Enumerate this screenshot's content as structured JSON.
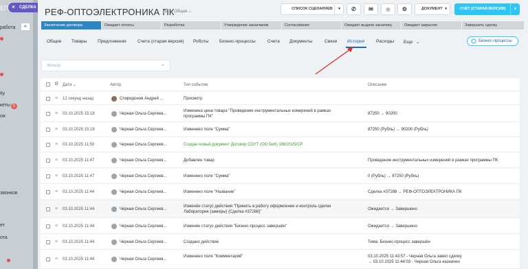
{
  "background": {
    "sidebar_fragments": [
      "работа",
      "ity",
      "кеты",
      "оя",
      "звонков",
      "ет",
      "ота"
    ],
    "sidebar_badge": "5",
    "top_logo_fragment": "ЕП"
  },
  "deal_tab": {
    "close_glyph": "✕",
    "label": "СДЕЛКА"
  },
  "collapse_icon": "«",
  "header": {
    "title": "РЕФ-ОПТОЭЛЕКТРОНИКА ПК",
    "title_icons": "🔗 ✎",
    "funnel": "Общая",
    "funnel_chevron": "⌄",
    "scenarios_label": "СПИСОК СЦЕНАРИЕВ",
    "scenarios_chevron": "▾",
    "phone_icon": "✆",
    "mail_icon": "✉",
    "status_icon": "◉",
    "gear_icon": "⚙",
    "document_label": "ДОКУМЕНТ",
    "document_chevron": "▾",
    "invoice_label": "СЧЁТ (СТАРАЯ ВЕРСИЯ)",
    "invoice_chevron": "▾"
  },
  "stages": [
    {
      "label": "Заключение договора",
      "active": true
    },
    {
      "label": "Ожидает оплаты",
      "active": false
    },
    {
      "label": "Разработка",
      "active": false
    },
    {
      "label": "Утверждение заказчиком",
      "active": false
    },
    {
      "label": "Согласование",
      "active": false
    },
    {
      "label": "Ожидает выдачи заказчику",
      "active": false
    },
    {
      "label": "Ожидает закрытия",
      "active": false
    },
    {
      "label": "Завершить сделку",
      "active": false
    }
  ],
  "tabs": [
    {
      "label": "Общие"
    },
    {
      "label": "Товары"
    },
    {
      "label": "Предложения"
    },
    {
      "label": "Счета (старая версия)"
    },
    {
      "label": "Роботы"
    },
    {
      "label": "Бизнес-процессы"
    },
    {
      "label": "Счета"
    },
    {
      "label": "Документы"
    },
    {
      "label": "Связи"
    },
    {
      "label": "История"
    },
    {
      "label": "Расходы"
    },
    {
      "label": "Еще"
    }
  ],
  "tabs_more_chevron": "⌄",
  "business_processes_button": "Бизнес-процессы",
  "filter": {
    "placeholder": "Фильтр",
    "search_icon": "⌕"
  },
  "table": {
    "columns": {
      "settings_icon": "⚙",
      "date": "Дата",
      "sort_arrow": "⌄",
      "author": "Автор",
      "event_type": "Тип события",
      "description": "Описание"
    },
    "menu_icon": "≡",
    "rows": [
      {
        "date": "12 секунд назад",
        "author": "Спиридонов Андрей ...",
        "event": "Просмотр",
        "event_2": "",
        "desc": "",
        "desc_2": "",
        "green": false,
        "photo": true
      },
      {
        "date": "03.10.2025 15:18",
        "author": "Черная Ольга Сергеев...",
        "event": "Изменена цена товара \"Проведение инструментальных измерений в рамках",
        "event_2": "программы ПК\"",
        "desc": "87250 → 90200",
        "desc_2": "",
        "green": false,
        "photo": false
      },
      {
        "date": "03.10.2025 15:18",
        "author": "Черная Ольга Сергеев...",
        "event": "Изменено поле \"Сумма\"",
        "event_2": "",
        "desc": "87250 (Рубль) → 90200 (Рубль)",
        "desc_2": "",
        "green": false,
        "photo": false
      },
      {
        "date": "03.10.2025 11:50",
        "author": "Черная Ольга Сергеев...",
        "event": "Создан новый документ Договор СОУТ (ОО БиК) 186/2025/СР",
        "event_2": "",
        "desc": "",
        "desc_2": "",
        "green": true,
        "photo": false
      },
      {
        "date": "03.10.2025 11:47",
        "author": "Черная Ольга Сергеев...",
        "event": "Добавлен товар",
        "event_2": "",
        "desc": "Проведение инструментальных измерений в рамках программы ПК",
        "desc_2": "",
        "green": false,
        "photo": false
      },
      {
        "date": "03.10.2025 11:47",
        "author": "Черная Ольга Сергеев...",
        "event": "Изменено поле \"Сумма\"",
        "event_2": "",
        "desc": "0 (Рубль) → 87250 (Рубль)",
        "desc_2": "",
        "green": false,
        "photo": false
      },
      {
        "date": "03.10.2025 11:44",
        "author": "Черная Ольга Сергеев...",
        "event": "Изменено поле \"Название\"",
        "event_2": "",
        "desc": "Сделка #37288 → РЕФ-ОПТОЭЛЕКТРОНИКА ПК",
        "desc_2": "",
        "green": false,
        "photo": false
      },
      {
        "date": "03.10.2025 11:44",
        "author": "Черная Ольга Сергеев...",
        "event": "Изменён статус действия \"Принять в работу оформление и контроль сделки",
        "event_2": "Лаборатория (замеры) (Сделка #37288)\"",
        "desc": "Ожидается → Завершено",
        "desc_2": "",
        "green": false,
        "photo": false
      },
      {
        "date": "03.10.2025 11:44",
        "author": "Черная Ольга Сергеев...",
        "event": "Изменён статус действия \"Бизнес-процесс завершён\"",
        "event_2": "",
        "desc": "Ожидается → Завершено",
        "desc_2": "",
        "green": false,
        "photo": false
      },
      {
        "date": "03.10.2025 11:44",
        "author": "Черная Ольга Сергеев...",
        "event": "Создано действие",
        "event_2": "",
        "desc": "Тема: Бизнес-процесс завершён",
        "desc_2": "",
        "green": false,
        "photo": false
      },
      {
        "date": "03.10.2025 11:44",
        "author": "Черная Ольга Сергеев...",
        "event": "Изменено поле \"Комментарий\"",
        "event_2": "",
        "desc": "03.10.2025 11:43:57 - Черная Ольга завел сделку",
        "desc_2": "→ 03.10.2025 11:44:03 - Черная Ольга назначен",
        "green": false,
        "photo": false
      }
    ]
  },
  "colors": {
    "accent_blue": "#2067b0",
    "stage_active": "#2e86c1",
    "invoice_button": "#2fc6f6",
    "annotation_arrow": "#d9302c",
    "green_text": "#3b9b2f"
  }
}
